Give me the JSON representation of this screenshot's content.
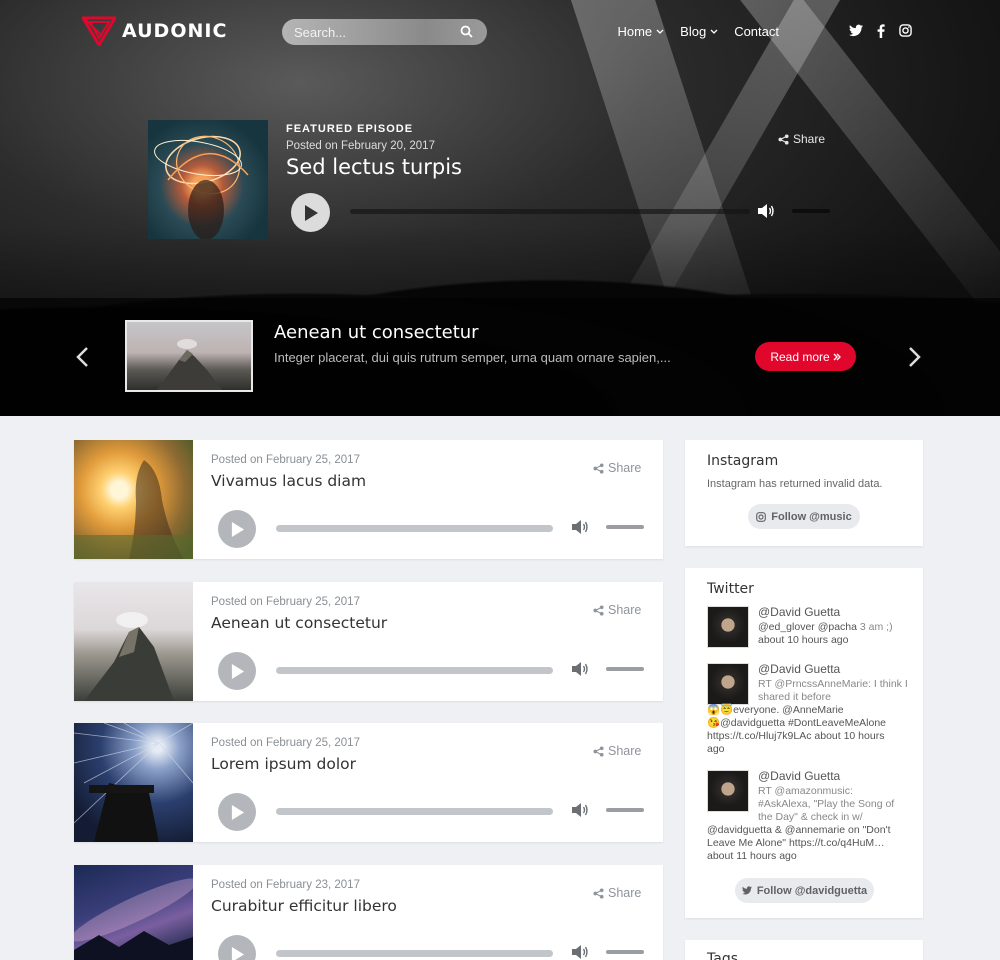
{
  "brand": {
    "name": "AUDONIC",
    "accent": "#e1072c"
  },
  "search": {
    "placeholder": "Search..."
  },
  "nav": {
    "home": "Home",
    "blog": "Blog",
    "contact": "Contact"
  },
  "social": [
    "twitter-icon",
    "facebook-icon",
    "instagram-icon"
  ],
  "featured": {
    "label": "FEATURED EPISODE",
    "date": "Posted on February 20, 2017",
    "title": "Sed lectus turpis",
    "share": "Share"
  },
  "slider": {
    "title": "Aenean ut consectetur",
    "text": "Integer placerat, dui quis rutrum semper, urna quam ornare sapien,...",
    "button": "Read more"
  },
  "episodes": [
    {
      "date": "Posted on February 25, 2017",
      "title": "Vivamus lacus diam",
      "share": "Share"
    },
    {
      "date": "Posted on February 25, 2017",
      "title": "Aenean ut consectetur",
      "share": "Share"
    },
    {
      "date": "Posted on February 25, 2017",
      "title": "Lorem ipsum dolor",
      "share": "Share"
    },
    {
      "date": "Posted on February 23, 2017",
      "title": "Curabitur efficitur libero",
      "share": "Share"
    }
  ],
  "instagram": {
    "title": "Instagram",
    "message": "Instagram has returned invalid data.",
    "follow": "Follow @music"
  },
  "twitter": {
    "title": "Twitter",
    "follow": "Follow @davidguetta",
    "tweets": [
      {
        "user": "@David Guetta",
        "text": "@ed_glover @pacha",
        "extra": "3 am ;)",
        "time": "about 10 hours ago"
      },
      {
        "user": "@David Guetta",
        "rt": "RT @PrncssAnneMarie: I think I shared it before",
        "line2": "😱😇everyone. @AnneMarie",
        "line3": "😘@davidguetta #DontLeaveMeAlone",
        "line4": "https://t.co/Hluj7k9LAc about 10 hours",
        "line5": "ago"
      },
      {
        "user": "@David Guetta",
        "rt": "RT @amazonmusic: #AskAlexa, \"Play the Song of the Day\" & check in w/",
        "line3": "@davidguetta & @annemarie on \"Don't",
        "line4": "Leave Me Alone\" https://t.co/q4HuM…",
        "line5": "about 11 hours ago"
      }
    ]
  },
  "tags": {
    "title": "Tags"
  }
}
